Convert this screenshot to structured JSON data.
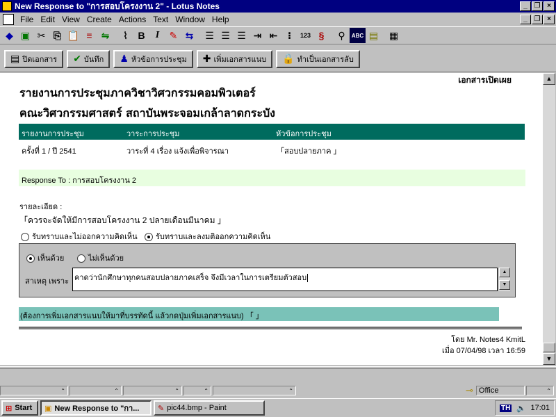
{
  "window": {
    "title": "New Response to \"การสอบโครงงาน 2\" - Lotus Notes"
  },
  "menu": [
    "File",
    "Edit",
    "View",
    "Create",
    "Actions",
    "Text",
    "Window",
    "Help"
  ],
  "toolbar_icons": [
    "smarticon-1",
    "save-icon",
    "cut-icon",
    "copy-icon",
    "paste-icon",
    "link-icon",
    "attach-icon",
    "bold-icon",
    "italic-icon",
    "highlight-icon",
    "text-color-icon",
    "align-left-icon",
    "align-center-icon",
    "align-right-icon",
    "indent-icon",
    "outdent-icon",
    "bullet-icon",
    "number-icon",
    "style-icon",
    "search-icon",
    "spell-icon",
    "properties-icon",
    "table-icon"
  ],
  "action_buttons": {
    "close": "ปิดเอกสาร",
    "save": "บันทึก",
    "topic": "หัวข้อการประชุม",
    "attach": "เพิ่มเอกสารแนบ",
    "private": "ทำเป็นเอกสารลับ"
  },
  "doc": {
    "tag": "เอกสารเปิดเผย",
    "title1": "รายงานการประชุมภาควิชาวิศวกรรมคอมพิวเตอร์",
    "title2": "คณะวิศวกรรมศาสตร์ สถาบันพระจอมเกล้าลาดกระบัง",
    "headers": {
      "report": "รายงานการประชุม",
      "agenda": "วาระการประชุม",
      "topic": "หัวข้อการประชุม"
    },
    "values": {
      "report": "ครั้งที่ 1 / ปี 2541",
      "agenda": "วาระที่ 4  เรื่อง แจ้งเพื่อพิจารณา",
      "topic": "สอบปลายภาค"
    },
    "response_to": "Response To : การสอบโครงงาน 2",
    "detail_label": "รายละเอียด :",
    "detail_value": "ควรจะจัดให้มีการสอบโครงงาน 2 ปลายเดือนมีนาคม",
    "radio1": "รับทราบและไม่ออกความคิดเห็น",
    "radio2": "รับทราบและลงมติออกความคิดเห็น",
    "agree": "เห็นด้วย",
    "disagree": "ไม่เห็นด้วย",
    "reason_label": "สาเหตุ เพราะ",
    "reason_value": "คาดว่านักศึกษาทุกคนสอบปลายภาคเสร็จ จึงมีเวลาในการเตรียมตัวสอบ",
    "attach_text": "(ต้องการเพิ่มเอกสารแนบให้มาที่บรรทัดนี้ แล้วกดปุ่มเพิ่มเอกสารแนบ)",
    "author": "โดย Mr. Notes4 KmitL",
    "date": "เมื่อ 07/04/98 เวลา 16:59"
  },
  "status": {
    "office": "Office"
  },
  "taskbar": {
    "start": "Start",
    "task1": "New Response to \"กา...",
    "task2": "pic44.bmp - Paint",
    "lang": "TH",
    "time": "17:01"
  }
}
